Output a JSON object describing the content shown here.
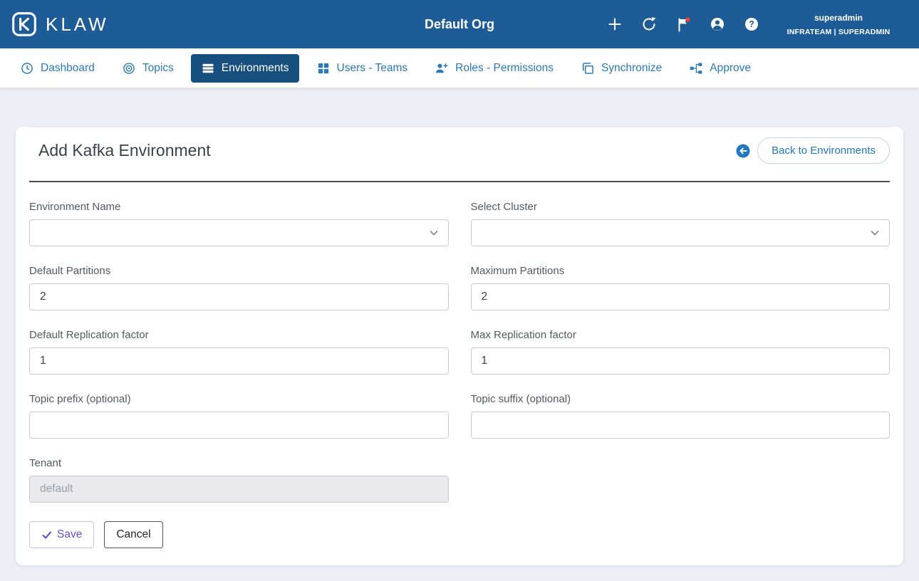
{
  "header": {
    "brand": "KLAW",
    "org_title": "Default Org",
    "user_name": "superadmin",
    "user_team_role": "INFRATEAM | SUPERADMIN"
  },
  "nav": {
    "items": [
      {
        "label": "Dashboard",
        "active": false
      },
      {
        "label": "Topics",
        "active": false
      },
      {
        "label": "Environments",
        "active": true
      },
      {
        "label": "Users - Teams",
        "active": false
      },
      {
        "label": "Roles - Permissions",
        "active": false
      },
      {
        "label": "Synchronize",
        "active": false
      },
      {
        "label": "Approve",
        "active": false
      }
    ]
  },
  "page": {
    "title": "Add Kafka Environment",
    "back_button_label": "Back to Environments"
  },
  "form": {
    "fields": {
      "environment_name": {
        "label": "Environment Name",
        "type": "select",
        "value": ""
      },
      "select_cluster": {
        "label": "Select Cluster",
        "type": "select",
        "value": ""
      },
      "default_partitions": {
        "label": "Default Partitions",
        "value": "2"
      },
      "maximum_partitions": {
        "label": "Maximum Partitions",
        "value": "2"
      },
      "default_replication_factor": {
        "label": "Default Replication factor",
        "value": "1"
      },
      "max_replication_factor": {
        "label": "Max Replication factor",
        "value": "1"
      },
      "topic_prefix": {
        "label": "Topic prefix (optional)",
        "value": ""
      },
      "topic_suffix": {
        "label": "Topic suffix (optional)",
        "value": ""
      },
      "tenant": {
        "label": "Tenant",
        "placeholder": "default",
        "disabled": true
      }
    },
    "buttons": {
      "save": "Save",
      "cancel": "Cancel"
    }
  },
  "icons": {
    "klaw-logo-icon": "rounded-square-K",
    "plus-icon": "+",
    "refresh-icon": "circular-arrow",
    "flag-icon": "flag-with-red-badge",
    "account-circle-icon": "person-in-circle",
    "help-icon": "question-in-circle",
    "arrow-left-circle-icon": "left-arrow-in-filled-circle",
    "chevron-down-icon": "v",
    "check-icon": "checkmark"
  },
  "colors": {
    "header_bg": "#1e5c97",
    "nav_link": "#2a7ab9",
    "nav_active_bg": "#17507f",
    "page_bg": "#edeef6",
    "notification_badge": "#e8453c",
    "save_accent": "#6a4fd4"
  }
}
